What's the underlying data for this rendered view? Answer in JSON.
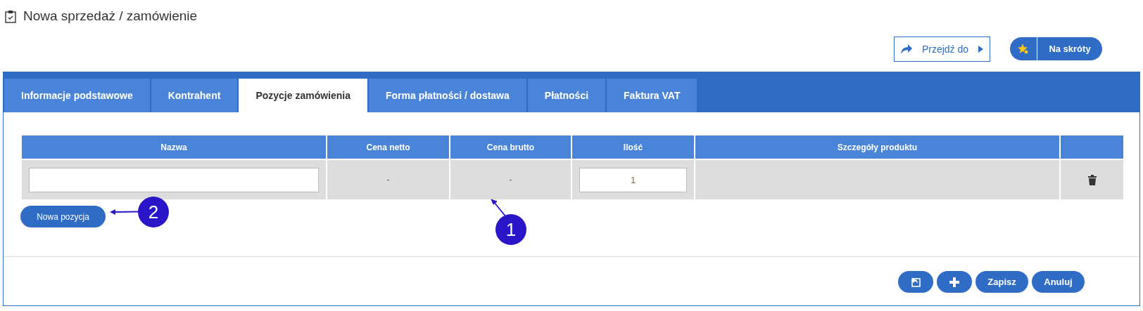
{
  "page_title": "Nowa sprzedaż / zamówienie",
  "header_buttons": {
    "goto": {
      "label": "Przejdź do"
    },
    "shortcuts": {
      "label": "Na skróty"
    }
  },
  "tabs": [
    {
      "label": "Informacje podstawowe",
      "selected": false
    },
    {
      "label": "Kontrahent",
      "selected": false
    },
    {
      "label": "Pozycje zamówienia",
      "selected": true
    },
    {
      "label": "Forma płatności / dostawa",
      "selected": false
    },
    {
      "label": "Płatności",
      "selected": false
    },
    {
      "label": "Faktura VAT",
      "selected": false
    }
  ],
  "table": {
    "columns": [
      "Nazwa",
      "Cena netto",
      "Cena brutto",
      "Ilość",
      "Szczegóły produktu"
    ],
    "rows": [
      {
        "name": "",
        "net_price": "-",
        "gross_price": "-",
        "quantity": "1"
      }
    ]
  },
  "add_item_button": "Nowa pozycja",
  "annotations": [
    {
      "number": "1"
    },
    {
      "number": "2"
    }
  ],
  "footer_buttons": [
    {
      "kind": "icon-import"
    },
    {
      "kind": "icon-plus"
    },
    {
      "kind": "text",
      "label": "Zapisz"
    },
    {
      "kind": "text",
      "label": "Anuluj"
    }
  ]
}
